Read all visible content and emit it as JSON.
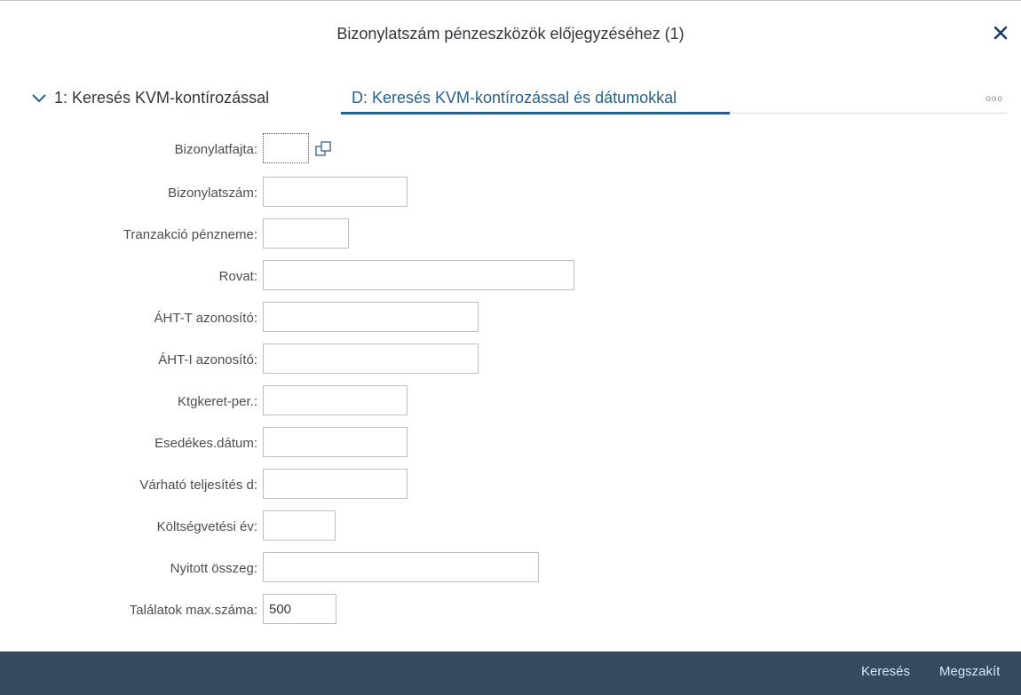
{
  "dialog": {
    "title": "Bizonylatszám pénzeszközök előjegyzéséhez (1)"
  },
  "tabs": {
    "collapsed_label": "1: Keresés KVM-kontírozással",
    "active_label": "D: Keresés KVM-kontírozással és dátumokkal",
    "more_label": "ooo"
  },
  "fields": [
    {
      "label": "Bizonylatfajta:",
      "value": "",
      "placeholder": ""
    },
    {
      "label": "Bizonylatszám:",
      "value": "",
      "placeholder": ""
    },
    {
      "label": "Tranzakció pénzneme:",
      "value": "",
      "placeholder": ""
    },
    {
      "label": "Rovat:",
      "value": "",
      "placeholder": ""
    },
    {
      "label": "ÁHT-T azonosító:",
      "value": "",
      "placeholder": ""
    },
    {
      "label": "ÁHT-I azonosító:",
      "value": "",
      "placeholder": ""
    },
    {
      "label": "Ktgkeret-per.:",
      "value": "",
      "placeholder": ""
    },
    {
      "label": "Esedékes.dátum:",
      "value": "",
      "placeholder": ""
    },
    {
      "label": "Várható teljesítés d:",
      "value": "",
      "placeholder": ""
    },
    {
      "label": "Költségvetési év:",
      "value": "",
      "placeholder": ""
    },
    {
      "label": "Nyitott összeg:",
      "value": "",
      "placeholder": ""
    },
    {
      "label": "Találatok max.száma:",
      "value": "500",
      "placeholder": ""
    }
  ],
  "footer": {
    "search_label": "Keresés",
    "cancel_label": "Megszakít"
  },
  "icons": {
    "close": "close-icon",
    "collapse": "chevron-down-icon",
    "value_help": "value-help-icon"
  },
  "colors": {
    "footer_bg": "#354a5f",
    "footer_text": "#d1e8ff",
    "tab_active": "#2b5f87"
  }
}
